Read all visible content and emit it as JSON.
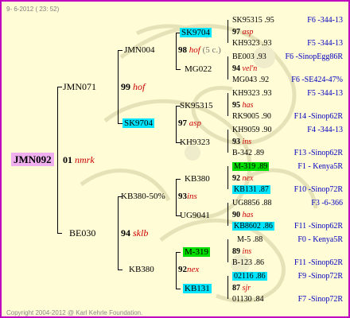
{
  "header": "9-  6-2012 ( 23: 52)",
  "footer": "Copyright 2004-2012 @ Karl Kehrle Foundation.",
  "colors": {
    "border": "#c000c0",
    "background": "#fffcd6",
    "cyan": "#00e5ff",
    "green": "#00dd00",
    "root": "#f0b0f0",
    "quality": "#cc0000",
    "right": "#0000c0"
  },
  "root": {
    "name": "JMN092",
    "num": "01",
    "q": "nmrk"
  },
  "g1": {
    "sire": {
      "name": "JMN071",
      "num": "99",
      "q": "hof"
    },
    "dam": {
      "name": "BE030",
      "num": "94",
      "q": "sklb"
    }
  },
  "g2": {
    "a": {
      "name": "JMN004",
      "num": "98",
      "q": "hof",
      "extra": "(5 c.)"
    },
    "b": {
      "name": "SK9704",
      "num": "97",
      "q": "asp"
    },
    "c": {
      "name": "KB380-50%",
      "num": "93",
      "q": "ins"
    },
    "d": {
      "name": "KB380",
      "num": "92",
      "q": "nex"
    }
  },
  "g3": {
    "a1": "SK9704",
    "a2": "MG022",
    "b1": "SK95315",
    "b2": "KH9323",
    "c1": "KB380",
    "c2": "UG9041",
    "d1": "M-319",
    "d2": "KB131"
  },
  "g4": [
    {
      "top": "SK95315 .95",
      "num": "97",
      "q": "asp",
      "bot": "KH9323 .93",
      "rt1": "F6 -344-13",
      "rt2": "F5 -344-13"
    },
    {
      "top": "BE003 .93",
      "num": "94",
      "q": "vel'n",
      "bot": "MG043 .92",
      "rt1": "F6 -SinopEgg86R",
      "rt2": "F6 -SE424-47%"
    },
    {
      "top": "KH9323 .93",
      "num": "95",
      "q": "has",
      "bot": "RK9005 .90",
      "rt1": "F5 -344-13",
      "rt2": "F14 -Sinop62R"
    },
    {
      "top": "KH9059 .90",
      "num": "93",
      "q": "ins",
      "bot": "B-342 .89",
      "rt1": "F4 -344-13",
      "rt2": "F13 -Sinop62R"
    },
    {
      "top": "M-319 .89",
      "num": "92",
      "q": "nex",
      "bot": "KB131 .87",
      "rt1": "F1 - Kenya5R",
      "rt2": "F10 -Sinop72R"
    },
    {
      "top": "UG8856 .88",
      "num": "90",
      "q": "has",
      "bot": "KB8602 .86",
      "rt1": "F3 -6-366",
      "rt2": "F11 -Sinop62R"
    },
    {
      "top": "M-5 .88",
      "num": "89",
      "q": "ins",
      "bot": "B-123 .86",
      "rt1": "F0 - Kenya5R",
      "rt2": "F11 -Sinop62R"
    },
    {
      "top": "02116 .86",
      "num": "87",
      "q": "sjr",
      "bot": "01130 .84",
      "rt1": "F9 -Sinop72R",
      "rt2": "F7 -Sinop72R"
    }
  ]
}
